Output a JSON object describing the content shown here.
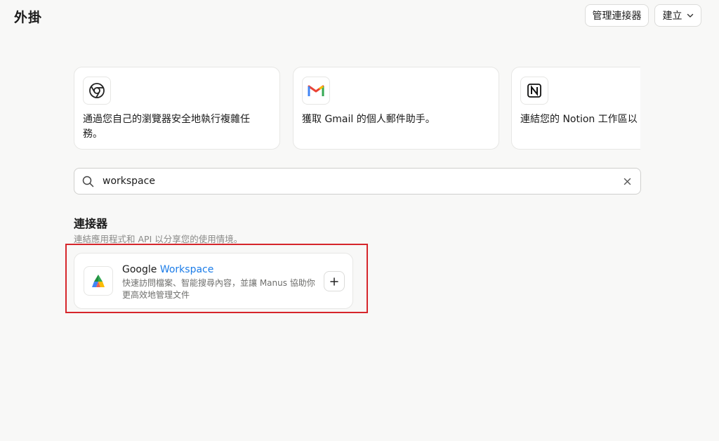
{
  "page": {
    "title": "外掛"
  },
  "header": {
    "manage_connectors_label": "管理連接器",
    "create_label": "建立"
  },
  "feature_cards": [
    {
      "icon": "chrome-icon",
      "text": "通過您自己的瀏覽器安全地執行複雜任務。"
    },
    {
      "icon": "gmail-icon",
      "text": "獲取 Gmail 的個人郵件助手。"
    },
    {
      "icon": "notion-icon",
      "text": "連結您的 Notion 工作區以"
    }
  ],
  "search": {
    "value": "workspace",
    "placeholder": ""
  },
  "connectors_section": {
    "title": "連接器",
    "subtitle": "連結應用程式和 API 以分享您的使用情境。",
    "items": [
      {
        "name_prefix": "Google ",
        "name_match": "Workspace",
        "description": "快速訪問檔案、智能搜尋內容，並讓 Manus 協助你更高效地管理文件",
        "icon": "google-workspace-icon",
        "action_icon": "plus-icon"
      }
    ]
  },
  "colors": {
    "background": "#f8f8f7",
    "search_highlight": "#1b7ce8",
    "annotation_frame": "#d6262b"
  }
}
